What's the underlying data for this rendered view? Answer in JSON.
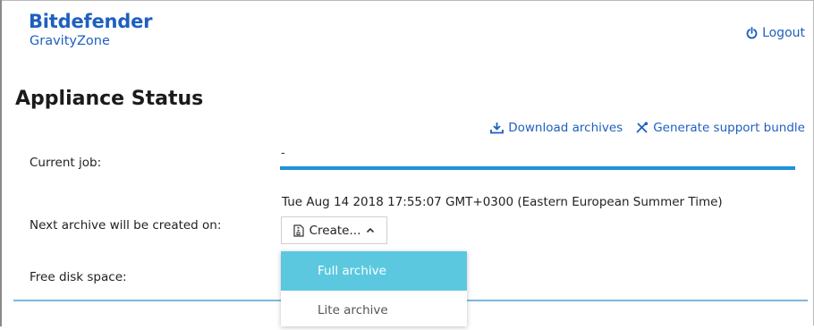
{
  "brand": {
    "name": "Bitdefender",
    "product": "GravityZone",
    "color": "#1f5fbf"
  },
  "header": {
    "logout_label": "Logout",
    "logout_icon": "power-icon"
  },
  "page": {
    "title": "Appliance Status"
  },
  "actions": {
    "download_label": "Download archives",
    "download_icon": "download-icon",
    "support_label": "Generate support bundle",
    "support_icon": "tools-icon"
  },
  "fields": {
    "current_job_label": "Current job:",
    "current_job_value": "-",
    "current_job_progress": 1.0,
    "next_archive_label": "Next archive will be created on:",
    "next_archive_value": "Tue Aug 14 2018 17:55:07 GMT+0300 (Eastern European Summer Time)",
    "free_disk_label": "Free disk space:"
  },
  "create_button": {
    "label": "Create...",
    "icon": "archive-icon",
    "caret": "chevron-up-icon"
  },
  "dropdown": {
    "items": [
      {
        "label": "Full archive",
        "active": true
      },
      {
        "label": "Lite archive",
        "active": false
      }
    ],
    "active_color": "#5bc8e0"
  },
  "colors": {
    "accent": "#1f5fbf",
    "progress": "#1d92d6",
    "divider": "#7fb8dd"
  }
}
